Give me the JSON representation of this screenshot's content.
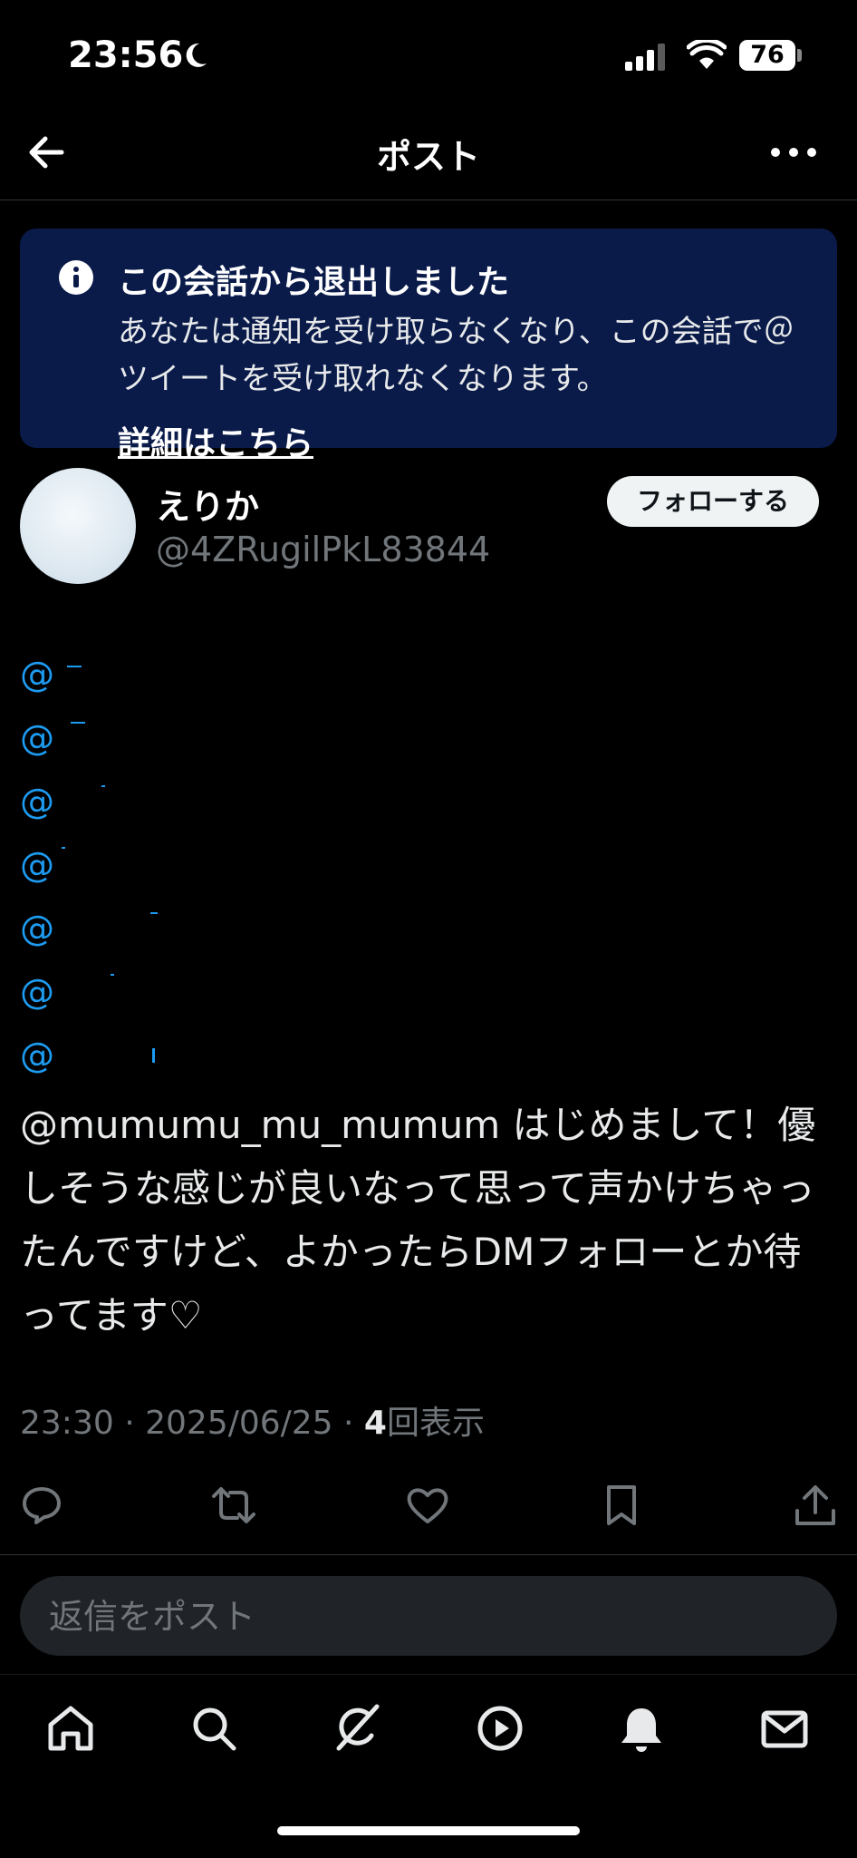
{
  "status_bar": {
    "time": "23:56",
    "battery": "76"
  },
  "header": {
    "title": "ポスト"
  },
  "notice": {
    "title": "この会話から退出しました",
    "body": "あなたは通知を受け取らなくなり、この会話で＠ツイートを受け取れなくなります。",
    "link": "詳細はこちら"
  },
  "author": {
    "name": "えりか",
    "handle": "@4ZRugilPkL83844",
    "follow_label": "フォローする"
  },
  "mentions": [
    "@",
    "@",
    "@",
    "@",
    "@",
    "@",
    "@"
  ],
  "tweet": {
    "text": "@mumumu_mu_mumum はじめまして！優しそうな感じが良いなって思って声かけちゃったんですけど、よかったらDMフォローとか待ってます♡",
    "time": "23:30 · 2025/06/25 · ",
    "views_count": "4",
    "views_label": "回表示"
  },
  "reply": {
    "placeholder": "返信をポスト"
  },
  "icons": {
    "back": "arrow-left-icon",
    "more": "more-horizontal-icon",
    "info": "info-icon",
    "reply": "reply-icon",
    "repost": "repost-icon",
    "like": "heart-icon",
    "bookmark": "bookmark-icon",
    "share": "share-icon",
    "nav": [
      "home-icon",
      "search-icon",
      "grok-icon",
      "play-icon",
      "bell-icon",
      "mail-icon"
    ]
  },
  "colors": {
    "accent": "#1d9bf0",
    "notice_bg": "#0a1b4a",
    "background": "#000000"
  }
}
